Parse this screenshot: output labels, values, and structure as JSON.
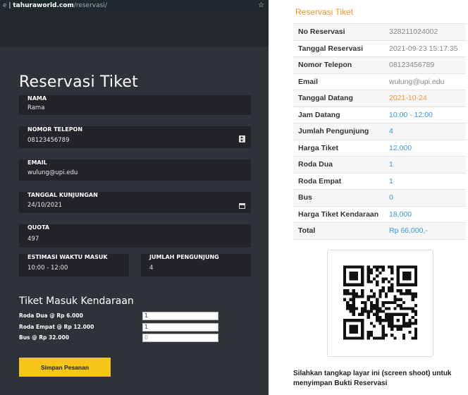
{
  "browser": {
    "url_host": "tahuraworld.com",
    "url_path": "/reservasi/",
    "prefix": "e"
  },
  "form": {
    "title": "Reservasi Tiket",
    "fields": {
      "nama": {
        "label": "NAMA",
        "value": "Rama"
      },
      "telepon": {
        "label": "NOMOR TELEPON",
        "value": "08123456789"
      },
      "email": {
        "label": "EMAIL",
        "value": "wulung@upi.edu"
      },
      "tanggal": {
        "label": "TANGGAL KUNJUNGAN",
        "value": "24/10/2021"
      },
      "quota": {
        "label": "QUOTA",
        "value": "497"
      },
      "estimasi": {
        "label": "ESTIMASI WAKTU MASUK",
        "value": "10:00 - 12:00"
      },
      "jumlah": {
        "label": "JUMLAH PENGUNJUNG",
        "value": "4"
      }
    },
    "kendaraan": {
      "title": "Tiket Masuk Kendaraan",
      "roda_dua": {
        "label": "Roda Dua @ Rp 6.000",
        "value": "1"
      },
      "roda_empat": {
        "label": "Roda Empat @ Rp 12.000",
        "value": "1"
      },
      "bus": {
        "label": "Bus @ Rp 32.000",
        "value": "0"
      }
    },
    "submit_label": "Simpan Pesanan"
  },
  "receipt": {
    "title": "Reservasi Tiket",
    "rows": [
      {
        "key": "No Reservasi",
        "value": "328211024002"
      },
      {
        "key": "Tanggal Reservasi",
        "value": "2021-09-23 15:17:35"
      },
      {
        "key": "Nomor Telepon",
        "value": "08123456789"
      },
      {
        "key": "Email",
        "value": "wulung@upi.edu"
      },
      {
        "key": "Tanggal Datang",
        "value": "2021-10-24"
      },
      {
        "key": "Jam Datang",
        "value": "10:00 - 12:00"
      },
      {
        "key": "Jumlah Pengunjung",
        "value": "4"
      },
      {
        "key": "Harga Tiket",
        "value": "12,000"
      },
      {
        "key": "Roda Dua",
        "value": "1"
      },
      {
        "key": "Roda Empat",
        "value": "1"
      },
      {
        "key": "Bus",
        "value": "0"
      },
      {
        "key": "Harga Tiket Kendaraan",
        "value": "18,000"
      },
      {
        "key": "Total",
        "value": "Rp 66,000,-"
      }
    ],
    "note": "Silahkan tangkap layar ini (screen shoot) untuk menyimpan Bukti Reservasi"
  },
  "colors": {
    "accent_orange": "#f2952a",
    "link_blue": "#3399e0",
    "button_yellow": "#f5c518",
    "panel_dark": "#2f3238"
  }
}
